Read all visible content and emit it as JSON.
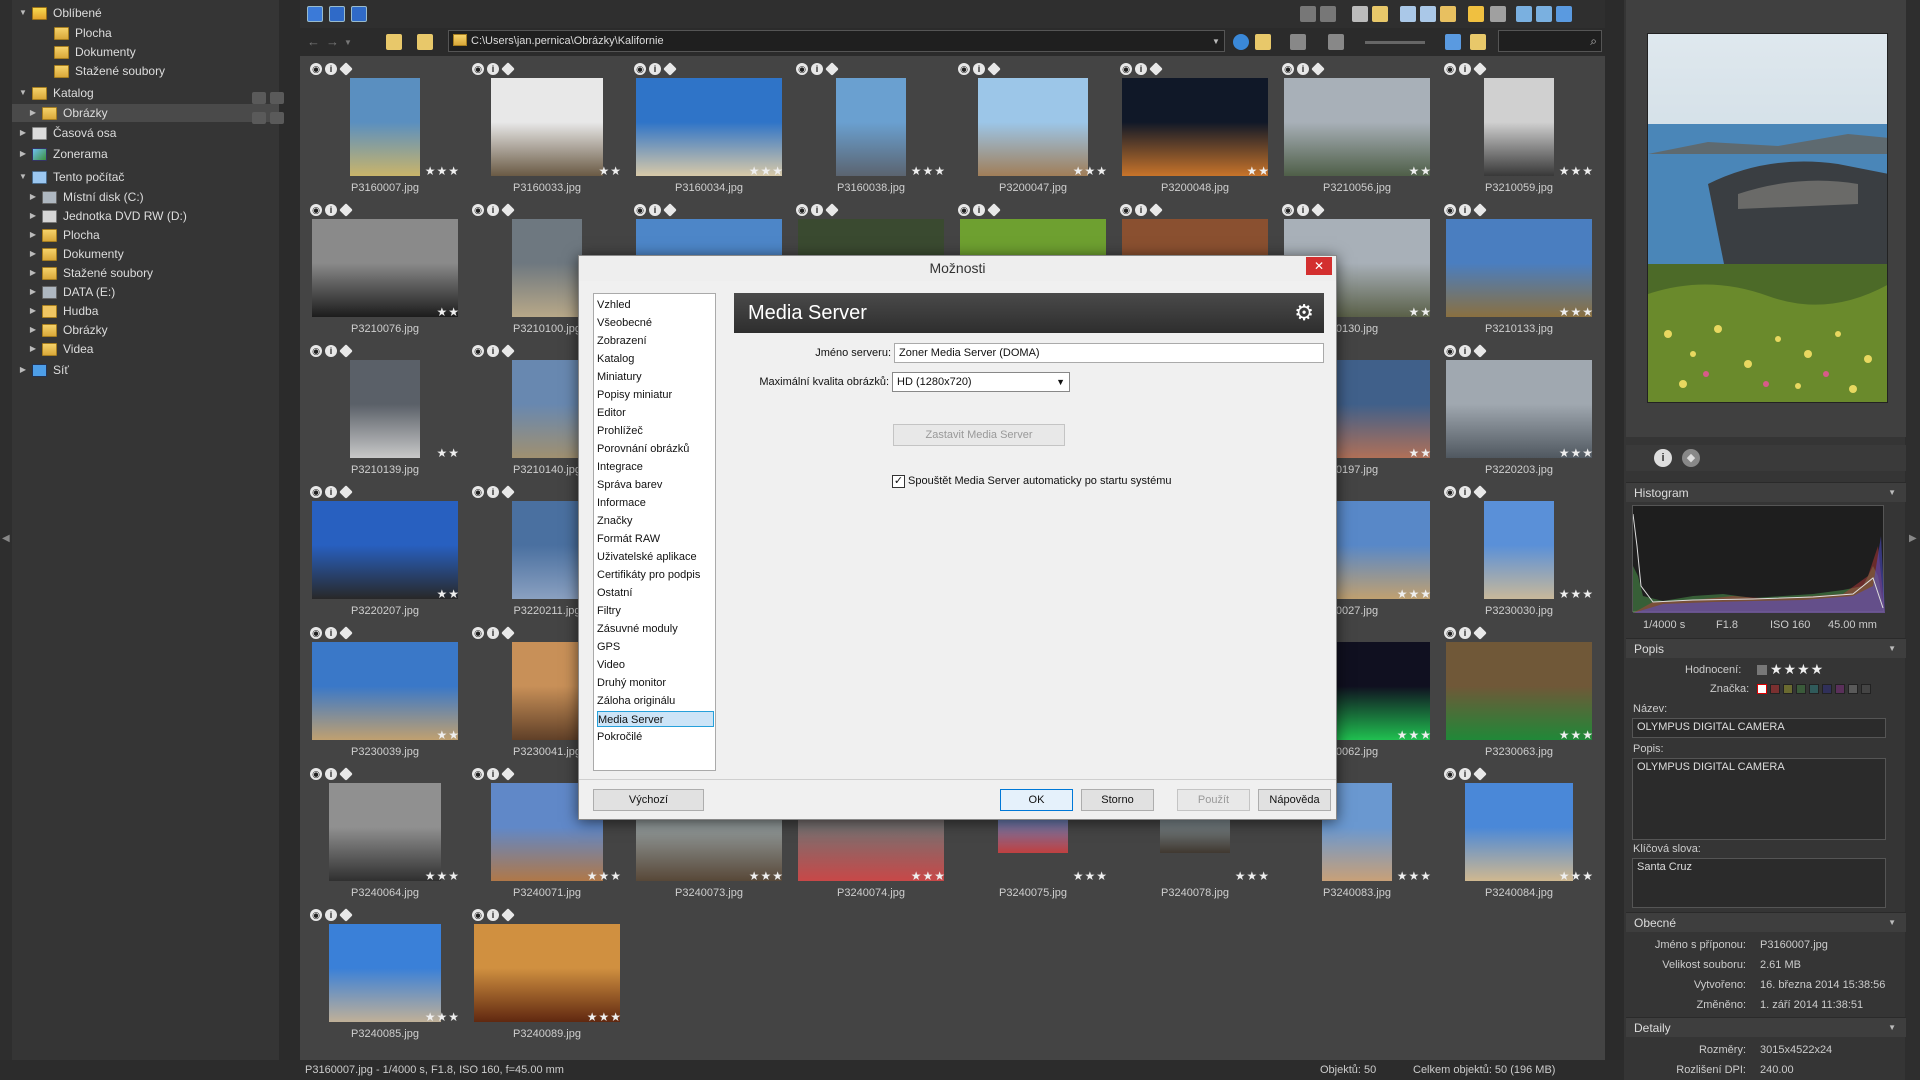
{
  "left_tree": {
    "items": [
      {
        "label": "Oblíbené",
        "icon": "star-folder-icon",
        "expand": "open"
      },
      {
        "label": "Plocha",
        "icon": "folder-icon"
      },
      {
        "label": "Dokumenty",
        "icon": "folder-icon"
      },
      {
        "label": "Stažené soubory",
        "icon": "folder-icon"
      },
      {
        "label": "Katalog",
        "icon": "catalog-folder-icon",
        "expand": "open"
      },
      {
        "label": "Obrázky",
        "icon": "folder-icon",
        "selected": true
      },
      {
        "label": "Časová osa",
        "icon": "calendar-icon"
      },
      {
        "label": "Zonerama",
        "icon": "zonerama-icon"
      },
      {
        "label": "Tento počítač",
        "icon": "computer-icon",
        "expand": "open"
      },
      {
        "label": "Místní disk (C:)",
        "icon": "disk-icon"
      },
      {
        "label": "Jednotka DVD RW (D:)",
        "icon": "dvd-icon"
      },
      {
        "label": "Plocha",
        "icon": "folder-icon"
      },
      {
        "label": "Dokumenty",
        "icon": "folder-icon"
      },
      {
        "label": "Stažené soubory",
        "icon": "folder-icon"
      },
      {
        "label": "DATA (E:)",
        "icon": "disk-icon"
      },
      {
        "label": "Hudba",
        "icon": "music-folder-icon"
      },
      {
        "label": "Obrázky",
        "icon": "folder-icon"
      },
      {
        "label": "Videa",
        "icon": "folder-icon"
      },
      {
        "label": "Síť",
        "icon": "network-icon"
      }
    ]
  },
  "address": {
    "path": "C:\\Users\\jan.pernica\\Obrázky\\Kalifornie"
  },
  "thumbnails": [
    {
      "name": "P3160007.jpg",
      "stars": "★★★",
      "c1": "#5a8fc0",
      "c2": "#c9b46a"
    },
    {
      "name": "P3160033.jpg",
      "stars": "★★",
      "c1": "#e8e8e8",
      "c2": "#6a5a44"
    },
    {
      "name": "P3160034.jpg",
      "stars": "★★★",
      "c1": "#2f74c8",
      "c2": "#d8c9a8"
    },
    {
      "name": "P3160038.jpg",
      "stars": "★★★",
      "c1": "#6aa0d0",
      "c2": "#5b6470"
    },
    {
      "name": "P3200047.jpg",
      "stars": "★★★",
      "c1": "#9cc6e8",
      "c2": "#a07e58"
    },
    {
      "name": "P3200048.jpg",
      "stars": "★★",
      "c1": "#101828",
      "c2": "#c8742a"
    },
    {
      "name": "P3210056.jpg",
      "stars": "★★",
      "c1": "#a8b0b8",
      "c2": "#4f5f48"
    },
    {
      "name": "P3210059.jpg",
      "stars": "★★★",
      "c1": "#d0d0d0",
      "c2": "#383838"
    },
    {
      "name": "P3210076.jpg",
      "stars": "★★",
      "c1": "#8a8a8a",
      "c2": "#1c1c1c"
    },
    {
      "name": "P3210100.jpg",
      "stars": "",
      "c1": "#6e7880",
      "c2": "#b8a888"
    },
    {
      "name": "",
      "stars": "",
      "c1": "#4d86c8",
      "c2": "#e0e8f0"
    },
    {
      "name": "",
      "stars": "",
      "c1": "#3a4a30",
      "c2": "#786040"
    },
    {
      "name": "",
      "stars": "",
      "c1": "#6ea030",
      "c2": "#c8d040"
    },
    {
      "name": "",
      "stars": "",
      "c1": "#8a5030",
      "c2": "#d0a070"
    },
    {
      "name": "0130.jpg",
      "stars": "★★",
      "c1": "#a8b0b8",
      "c2": "#5a6048"
    },
    {
      "name": "P3210133.jpg",
      "stars": "★★★",
      "c1": "#4a7ec0",
      "c2": "#8a7040"
    },
    {
      "name": "P3210139.jpg",
      "stars": "★★",
      "c1": "#5a6068",
      "c2": "#c8c8c8"
    },
    {
      "name": "P3210140.jpg",
      "stars": "",
      "c1": "#6888b0",
      "c2": "#a09070"
    },
    {
      "name": "0197.jpg",
      "stars": "★★",
      "c1": "#40608a",
      "c2": "#b07058"
    },
    {
      "name": "P3220203.jpg",
      "stars": "★★★",
      "c1": "#a0a8b0",
      "c2": "#505860"
    },
    {
      "name": "P3220207.jpg",
      "stars": "★★",
      "c1": "#2860c0",
      "c2": "#282828"
    },
    {
      "name": "P3220211.jpg",
      "stars": "",
      "c1": "#4a70a0",
      "c2": "#8aa0c0"
    },
    {
      "name": "0027.jpg",
      "stars": "★★★",
      "c1": "#5888c8",
      "c2": "#c0a070"
    },
    {
      "name": "P3230030.jpg",
      "stars": "★★★",
      "c1": "#5a90d8",
      "c2": "#c8b89a"
    },
    {
      "name": "P3230039.jpg",
      "stars": "★★",
      "c1": "#3a78c8",
      "c2": "#c0a070"
    },
    {
      "name": "P3230041.jpg",
      "stars": "",
      "c1": "#c89058",
      "c2": "#604028"
    },
    {
      "name": "0062.jpg",
      "stars": "★★★",
      "c1": "#101020",
      "c2": "#20c050"
    },
    {
      "name": "P3230063.jpg",
      "stars": "★★★",
      "c1": "#705838",
      "c2": "#208838"
    },
    {
      "name": "P3240064.jpg",
      "stars": "★★★",
      "c1": "#909090",
      "c2": "#303030"
    },
    {
      "name": "P3240071.jpg",
      "stars": "★★★",
      "c1": "#6088c8",
      "c2": "#b07848"
    },
    {
      "name": "P3240073.jpg",
      "stars": "★★★",
      "c1": "#909898",
      "c2": "#584838"
    },
    {
      "name": "P3240074.jpg",
      "stars": "★★★",
      "c1": "#787070",
      "c2": "#c84848"
    },
    {
      "name": "P3240075.jpg",
      "stars": "★★★",
      "c1": "#5a88c8",
      "c2": "#c04040"
    },
    {
      "name": "P3240078.jpg",
      "stars": "★★★",
      "c1": "#8898a0",
      "c2": "#403830"
    },
    {
      "name": "P3240083.jpg",
      "stars": "★★★",
      "c1": "#6a98d0",
      "c2": "#c8a078"
    },
    {
      "name": "P3240084.jpg",
      "stars": "★★★",
      "c1": "#4a88d8",
      "c2": "#d0b890"
    },
    {
      "name": "P3240085.jpg",
      "stars": "★★★",
      "c1": "#3a80d8",
      "c2": "#c0b098"
    },
    {
      "name": "P3240089.jpg",
      "stars": "★★★",
      "c1": "#d09040",
      "c2": "#602810"
    }
  ],
  "status": {
    "left": "P3160007.jpg - 1/4000 s, F1.8, ISO 160, f=45.00 mm",
    "objects": "Objektů: 50",
    "total": "Celkem objektů: 50 (196 MB)"
  },
  "right_panel": {
    "histogram_title": "Histogram",
    "exif": {
      "shutter": "1/4000 s",
      "aperture": "F1.8",
      "iso": "ISO 160",
      "focal": "45.00 mm"
    },
    "popis_title": "Popis",
    "rating_label": "Hodnocení:",
    "rating": "★★★★",
    "tag_label": "Značka:",
    "name_label": "Název:",
    "name_value": "OLYMPUS DIGITAL CAMERA",
    "desc_label": "Popis:",
    "desc_value": "OLYMPUS DIGITAL CAMERA",
    "keywords_label": "Klíčová slova:",
    "keywords_value": "Santa Cruz",
    "general_title": "Obecné",
    "general": [
      {
        "label": "Jméno s příponou:",
        "value": "P3160007.jpg"
      },
      {
        "label": "Velikost souboru:",
        "value": "2.61 MB"
      },
      {
        "label": "Vytvořeno:",
        "value": "16. března 2014 15:38:56"
      },
      {
        "label": "Změněno:",
        "value": "1. září 2014 11:38:51"
      }
    ],
    "details_title": "Detaily",
    "details": [
      {
        "label": "Rozměry:",
        "value": "3015x4522x24"
      },
      {
        "label": "Rozlišení DPI:",
        "value": "240.00"
      }
    ]
  },
  "dialog": {
    "title": "Možnosti",
    "close": "✕",
    "nav": [
      "Vzhled",
      "Všeobecné",
      "Zobrazení",
      "Katalog",
      "Miniatury",
      "Popisy miniatur",
      "Editor",
      "Prohlížeč",
      "Porovnání obrázků",
      "Integrace",
      "Správa barev",
      "Informace",
      "Značky",
      "Formát RAW",
      "Uživatelské aplikace",
      "Certifikáty pro podpis",
      "Ostatní",
      "Filtry",
      "Zásuvné moduly",
      "GPS",
      "Video",
      "Druhý monitor",
      "Záloha originálu",
      "Media Server",
      "Pokročilé"
    ],
    "selected_index": 23,
    "header": "Media Server",
    "server_name_label": "Jméno serveru:",
    "server_name_value": "Zoner Media Server (DOMA)",
    "quality_label": "Maximální kvalita obrázků:",
    "quality_value": "HD (1280x720)",
    "stop_button": "Zastavit Media Server",
    "autostart_label": "Spouštět Media Server automaticky po startu systému",
    "autostart_checked": "✓",
    "default_button": "Výchozí",
    "ok_button": "OK",
    "cancel_button": "Storno",
    "apply_button": "Použít",
    "help_button": "Nápověda"
  }
}
